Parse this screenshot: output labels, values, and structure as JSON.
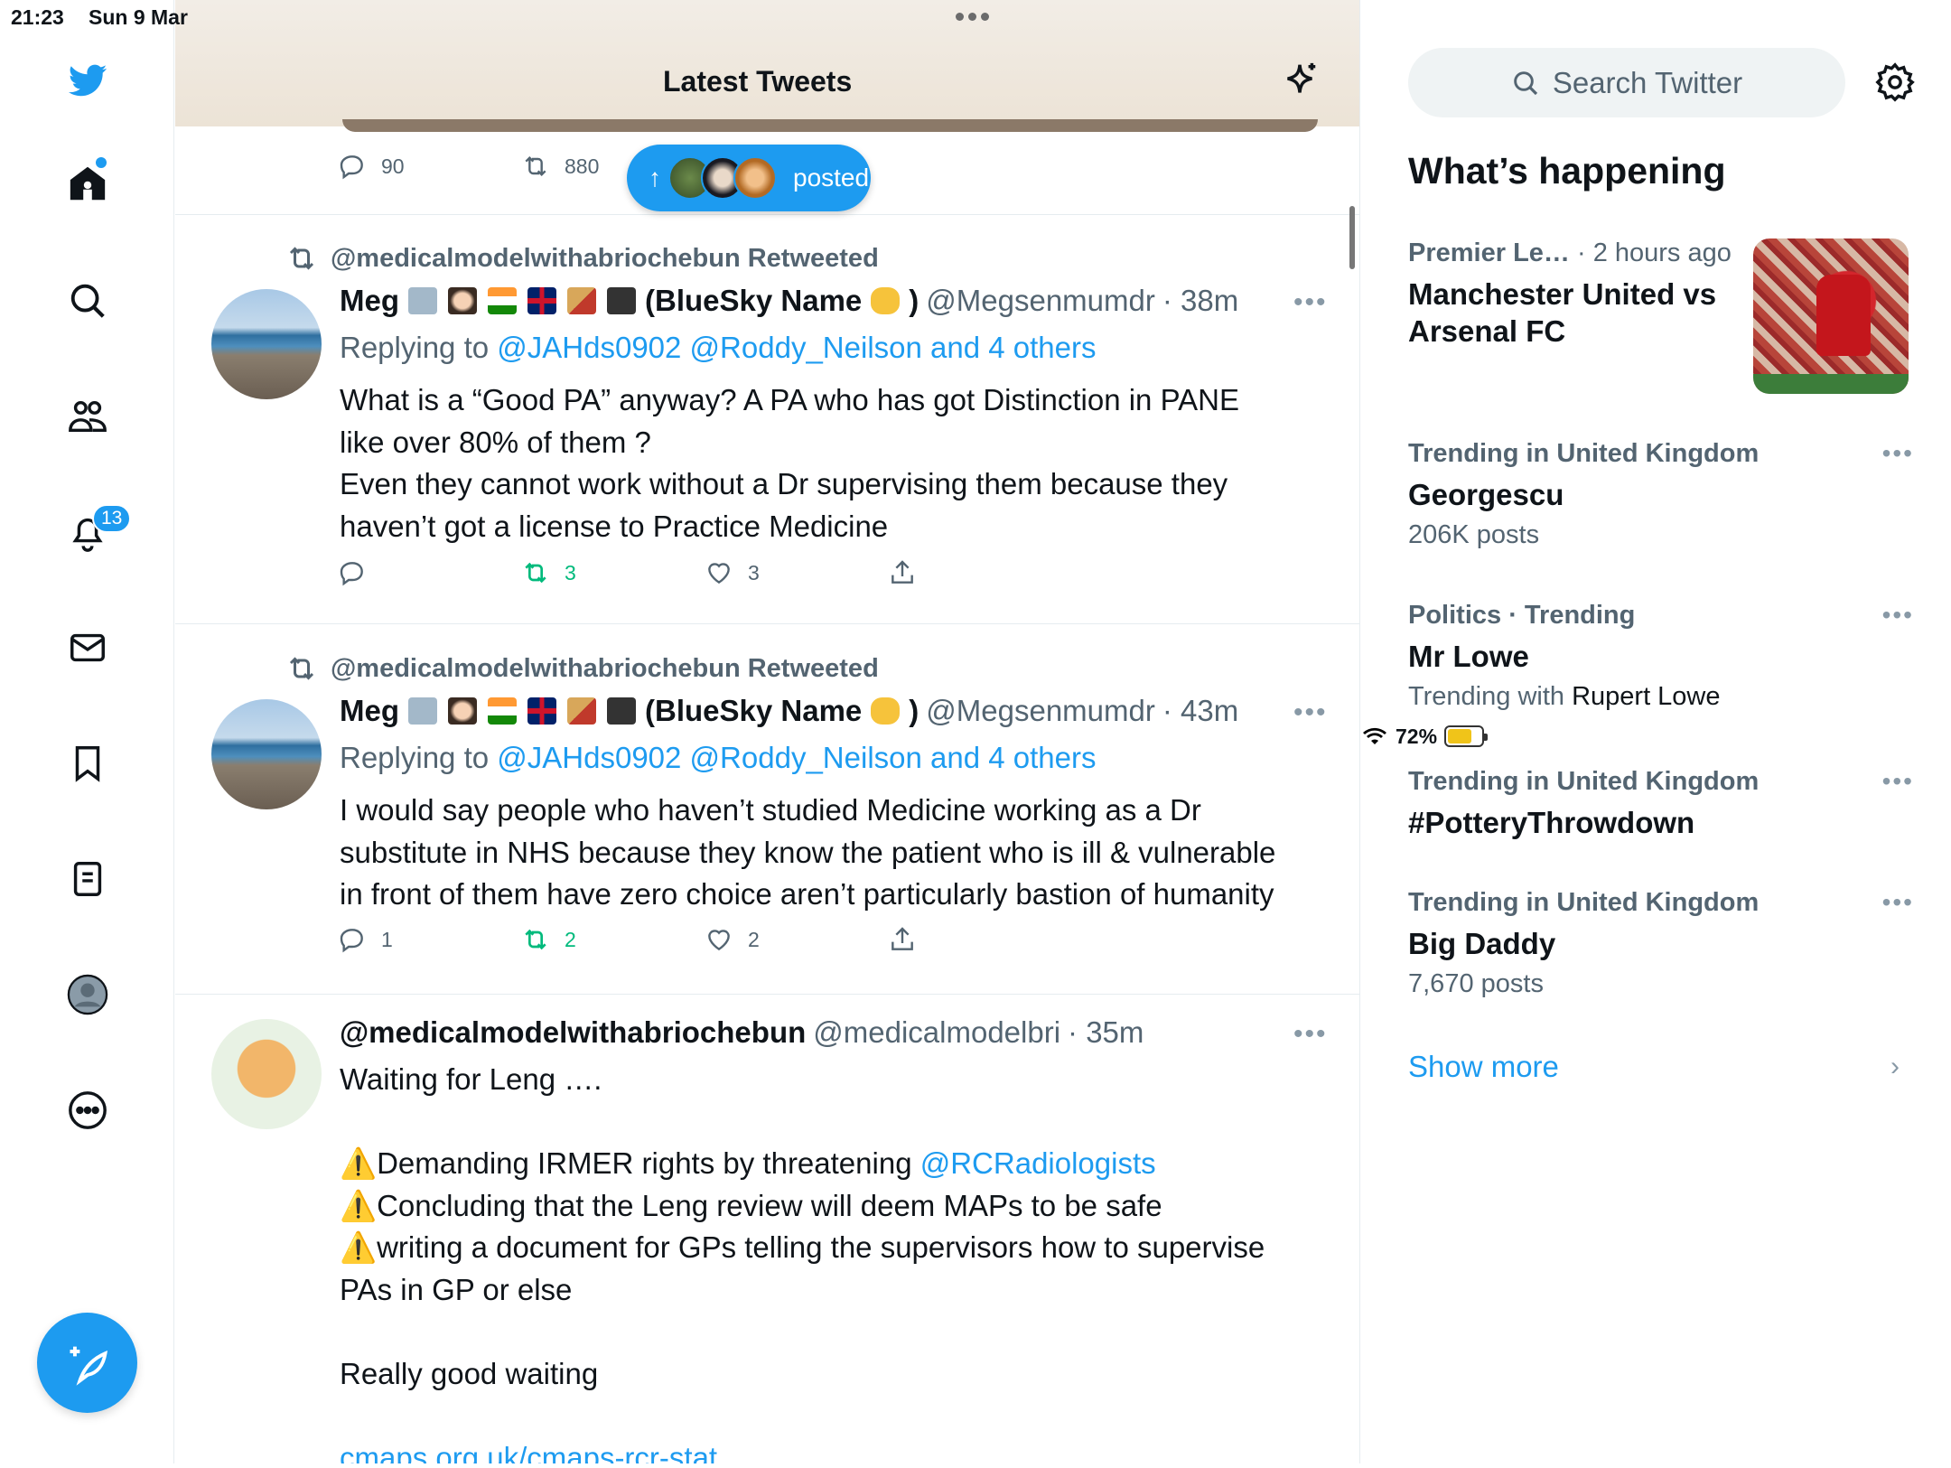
{
  "status": {
    "time": "21:23",
    "date": "Sun 9 Mar",
    "battery": "72%",
    "battery_level": 0.72
  },
  "nav": {
    "notifications_badge": "13"
  },
  "header": {
    "title": "Latest Tweets"
  },
  "new_posts_pill": {
    "label": "posted"
  },
  "prev_tweet": {
    "replies": "90",
    "retweets": "880"
  },
  "tweets": [
    {
      "retweeted_by": "@medicalmodelwithabriochebun Retweeted",
      "name": "Meg",
      "name_suffix": "(BlueSky Name",
      "name_close": ")",
      "handle": "@Megsenmumdr",
      "time": "· 38m",
      "replying_prefix": "Replying to",
      "replying_to": "@JAHds0902 @Roddy_Neilson and 4 others",
      "lines": [
        "What is a “Good PA” anyway? A PA who has got Distinction in PANE",
        "like over 80% of them ?",
        "Even they cannot work without a Dr supervising them because they",
        "haven’t got a license to Practice Medicine"
      ],
      "replies": "",
      "retweets": "3",
      "likes": "3"
    },
    {
      "retweeted_by": "@medicalmodelwithabriochebun Retweeted",
      "name": "Meg",
      "name_suffix": "(BlueSky Name",
      "name_close": ")",
      "handle": "@Megsenmumdr",
      "time": "· 43m",
      "replying_prefix": "Replying to",
      "replying_to": "@JAHds0902 @Roddy_Neilson and 4 others",
      "lines": [
        "I would say people who haven’t studied Medicine working as a Dr",
        "substitute in NHS because they know the patient who is ill & vulnerable",
        "in front of them have zero choice aren’t particularly bastion of humanity"
      ],
      "replies": "1",
      "retweets": "2",
      "likes": "2"
    },
    {
      "name": "@medicalmodelwithabriochebun",
      "handle": "@medicalmodelbri",
      "time": "· 35m",
      "line1": "Waiting for Leng ….",
      "bullet1_text": "Demanding IRMER rights by threatening ",
      "bullet1_mention": "@RCRadiologists",
      "bullet2": "Concluding that the Leng review will deem MAPs to be safe",
      "bullet3a": "writing a document for GPs telling the supervisors how to supervise",
      "bullet3b": "PAs in GP or else",
      "line_last": "Really good waiting",
      "link": "cmaps.org.uk/cmaps-rcr-stat…"
    }
  ],
  "sidebar": {
    "search_placeholder": "Search Twitter",
    "heading": "What’s happening",
    "trends": [
      {
        "meta": "Premier Le…",
        "meta_extra": " · 2 hours ago",
        "title": "Manchester United vs Arsenal FC"
      },
      {
        "meta": "Trending in United Kingdom",
        "title": "Georgescu",
        "sub": "206K posts"
      },
      {
        "meta": "Politics · Trending",
        "title": "Mr Lowe",
        "sub_prefix": "Trending with ",
        "sub_strong": "Rupert Lowe"
      },
      {
        "meta": "Trending in United Kingdom",
        "title": "#PotteryThrowdown"
      },
      {
        "meta": "Trending in United Kingdom",
        "title": "Big Daddy",
        "sub": "7,670 posts"
      }
    ],
    "show_more": "Show more"
  }
}
